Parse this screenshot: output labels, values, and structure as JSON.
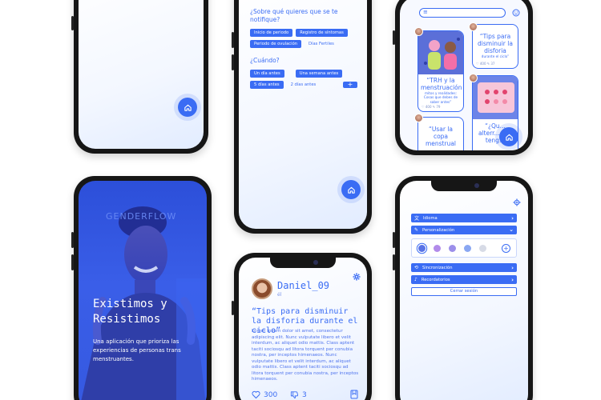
{
  "notifications": {
    "question_topic": "¿Sobre qué quieres que se te notifique?",
    "topics": [
      {
        "label": "Inicio de periodo",
        "selected": true
      },
      {
        "label": "Registro de síntomas",
        "selected": true
      },
      {
        "label": "Periodo de ovulación",
        "selected": true
      },
      {
        "label": "Días Fertiles",
        "selected": false
      }
    ],
    "question_when": "¿Cuándo?",
    "when_options": [
      {
        "label": "Un día antes",
        "selected": true
      },
      {
        "label": "Una semana antes",
        "selected": true
      },
      {
        "label": "5 días antes",
        "selected": true
      },
      {
        "label": "2 días antes",
        "selected": false
      }
    ],
    "add_label": "+"
  },
  "feed": {
    "cards": [
      {
        "title": "“TRH y la menstruación",
        "subtitle": "mitos y realidades: Cosas que debes de saber antes”",
        "stats": "♡ 400  ✎ 79"
      },
      {
        "title": "“Tips para disminuir la disforia",
        "subtitle": "durante el ciclo”",
        "stats": "♡ 400  ✎ 37"
      },
      {
        "title": "“Usar la copa menstrual",
        "subtitle": ""
      },
      {
        "title": "“¿Qu... alterr... vas teng...",
        "subtitle": ""
      }
    ]
  },
  "hero": {
    "logo": "GENDERFLOW",
    "headline_line1": "Existimos y",
    "headline_line2": "Resistimos",
    "description": "Una aplicación que prioriza las experiencias de personas trans menstruantes."
  },
  "post": {
    "author": "Daniel_09",
    "pronoun": "él",
    "title": "“Tips para disminuir la disforia durante el ciclo”",
    "body": "Lorem ipsum dolor sit amet, consectetur adipiscing elit. Nunc vulputate libero et velit interdum, ac aliquet odio mattis. Class aptent taciti sociosqu ad litora torquent per conubia nostra, per inceptos himenaeos. Nunc vulputate libero et velit interdum, ac aliquet odio mattis. Class aptent taciti sociosqu ad litora torquent per conubia nostra, per inceptos himenaeos.",
    "likes": "300",
    "dislikes": "3"
  },
  "settings": {
    "items": [
      {
        "label": "Idioma",
        "icon": "translate-icon",
        "chevron": "›"
      },
      {
        "label": "Personalización",
        "icon": "brush-icon",
        "chevron": "⌄"
      },
      {
        "label": "Sincronización",
        "icon": "sync-icon",
        "chevron": "›"
      },
      {
        "label": "Recordatorios",
        "icon": "bell-icon",
        "chevron": "›"
      }
    ],
    "swatches": [
      "#5a74e6",
      "#b28bea",
      "#9c8fea",
      "#8aa7f2",
      "#d7dbe6"
    ],
    "logout_label": "Cerrar sesión",
    "add_swatch_label": "+"
  },
  "colors": {
    "accent": "#3a6cf4",
    "frame": "#161616"
  }
}
